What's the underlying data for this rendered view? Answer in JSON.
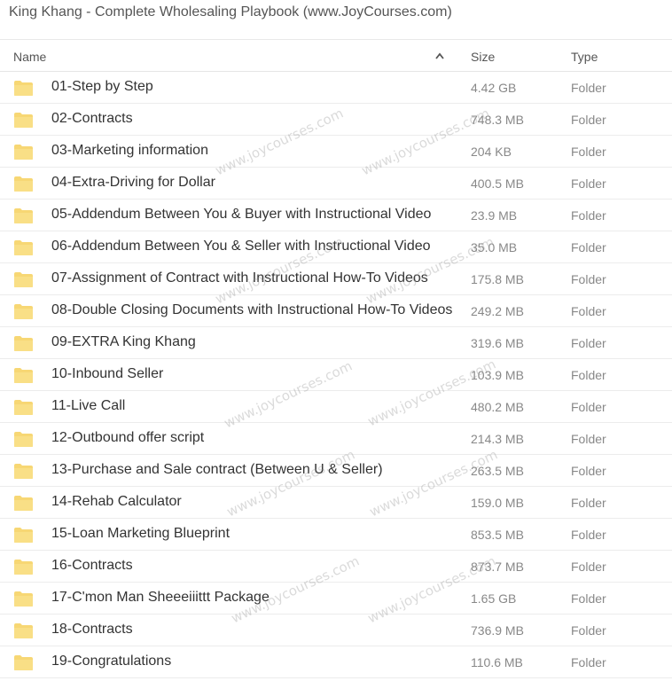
{
  "title": "King Khang - Complete Wholesaling Playbook (www.JoyCourses.com)",
  "columns": {
    "name": "Name",
    "size": "Size",
    "type": "Type",
    "sort": "ascending"
  },
  "watermark_text": "www.joycourses.com",
  "icons": {
    "folder": "folder-icon",
    "sort": "chevron-up-icon"
  },
  "colors": {
    "folder": "#f7d774"
  },
  "rows": [
    {
      "name": "01-Step by Step",
      "size": "4.42 GB",
      "type": "Folder"
    },
    {
      "name": "02-Contracts",
      "size": "748.3 MB",
      "type": "Folder"
    },
    {
      "name": "03-Marketing information",
      "size": "204 KB",
      "type": "Folder"
    },
    {
      "name": "04-Extra-Driving for Dollar",
      "size": "400.5 MB",
      "type": "Folder"
    },
    {
      "name": "05-Addendum Between You & Buyer with Instructional Video",
      "size": "23.9 MB",
      "type": "Folder"
    },
    {
      "name": "06-Addendum Between You & Seller with Instructional Video",
      "size": "35.0 MB",
      "type": "Folder"
    },
    {
      "name": "07-Assignment of Contract with Instructional How-To Videos",
      "size": "175.8 MB",
      "type": "Folder"
    },
    {
      "name": "08-Double Closing Documents with Instructional How-To Videos",
      "size": "249.2 MB",
      "type": "Folder"
    },
    {
      "name": "09-EXTRA King Khang",
      "size": "319.6 MB",
      "type": "Folder"
    },
    {
      "name": "10-Inbound Seller",
      "size": "103.9 MB",
      "type": "Folder"
    },
    {
      "name": "11-Live Call",
      "size": "480.2 MB",
      "type": "Folder"
    },
    {
      "name": "12-Outbound offer script",
      "size": "214.3 MB",
      "type": "Folder"
    },
    {
      "name": "13-Purchase and Sale contract (Between U & Seller)",
      "size": "263.5 MB",
      "type": "Folder"
    },
    {
      "name": "14-Rehab Calculator",
      "size": "159.0 MB",
      "type": "Folder"
    },
    {
      "name": "15-Loan Marketing Blueprint",
      "size": "853.5 MB",
      "type": "Folder"
    },
    {
      "name": "16-Contracts",
      "size": "873.7 MB",
      "type": "Folder"
    },
    {
      "name": "17-C'mon Man Sheeeiiittt Package",
      "size": "1.65 GB",
      "type": "Folder"
    },
    {
      "name": "18-Contracts",
      "size": "736.9 MB",
      "type": "Folder"
    },
    {
      "name": "19-Congratulations",
      "size": "110.6 MB",
      "type": "Folder"
    }
  ]
}
